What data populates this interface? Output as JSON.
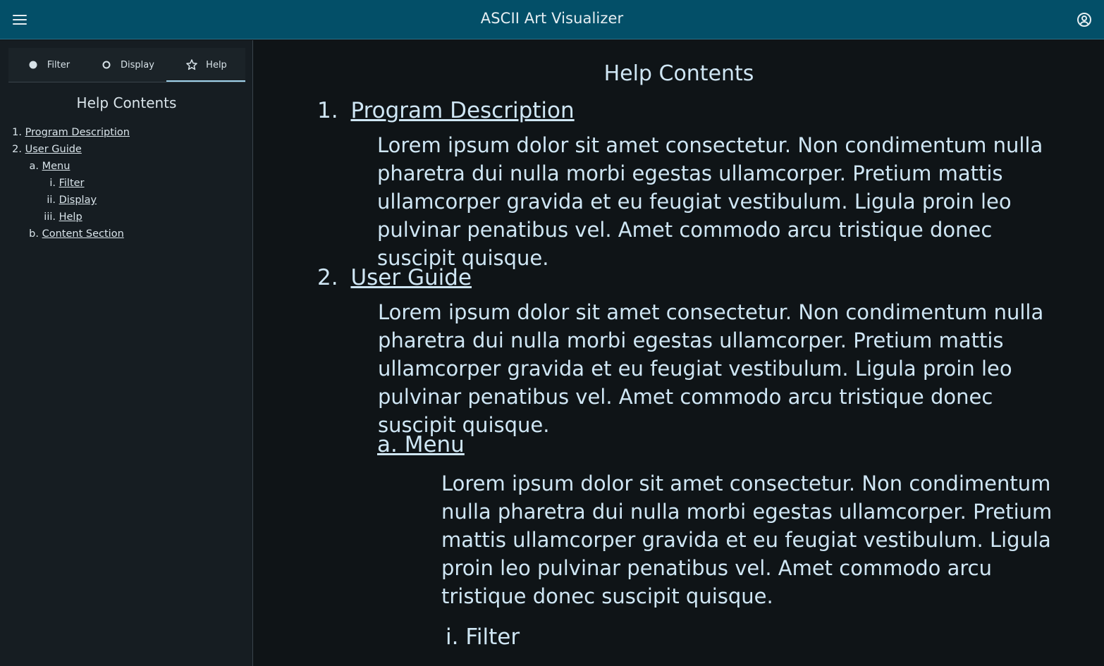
{
  "header": {
    "title": "ASCII Art Visualizer",
    "menu_icon": "hamburger-menu-icon",
    "account_icon": "account-circle-icon"
  },
  "sidebar": {
    "tabs": [
      {
        "label": "Filter",
        "icon": "filled-circle-icon",
        "active": false
      },
      {
        "label": "Display",
        "icon": "outline-circle-icon",
        "active": false
      },
      {
        "label": "Help",
        "icon": "star-outline-icon",
        "active": true
      }
    ],
    "heading": "Help Contents",
    "toc": [
      {
        "marker": "1.",
        "label": "Program Description"
      },
      {
        "marker": "2.",
        "label": "User Guide"
      },
      {
        "marker": "a.",
        "label": "Menu"
      },
      {
        "marker": "i.",
        "label": "Filter"
      },
      {
        "marker": "ii.",
        "label": "Display"
      },
      {
        "marker": "iii.",
        "label": "Help"
      },
      {
        "marker": "b.",
        "label": "Content Section"
      }
    ]
  },
  "main": {
    "title": "Help Contents",
    "sections": [
      {
        "marker": "1.",
        "heading": "Program Description",
        "body": "Lorem ipsum dolor sit amet consectetur. Non condimentum nulla pharetra dui nulla morbi egestas ullamcorper. Pretium mattis ullamcorper gravida et eu feugiat vestibulum. Ligula proin leo pulvinar penatibus vel. Amet commodo arcu tristique donec suscipit quisque."
      },
      {
        "marker": "2.",
        "heading": "User Guide",
        "body": "Lorem ipsum dolor sit amet consectetur. Non condimentum nulla pharetra dui nulla morbi egestas ullamcorper. Pretium mattis ullamcorper gravida et eu feugiat vestibulum. Ligula proin leo pulvinar penatibus vel. Amet commodo arcu tristique donec suscipit quisque."
      },
      {
        "marker": "",
        "heading": "a. Menu",
        "body": "Lorem ipsum dolor sit amet consectetur. Non condimentum nulla pharetra dui nulla morbi egestas ullamcorper. Pretium mattis ullamcorper gravida et eu feugiat vestibulum. Ligula proin leo pulvinar penatibus vel. Amet commodo arcu tristique donec suscipit quisque."
      },
      {
        "marker": "",
        "heading": "i. Filter",
        "body": ""
      }
    ]
  },
  "colors": {
    "topbar": "#034f68",
    "sidebar": "#161d22",
    "main_bg": "#0f1417",
    "text": "#cfe6f4",
    "accent": "#9fd2ea"
  }
}
